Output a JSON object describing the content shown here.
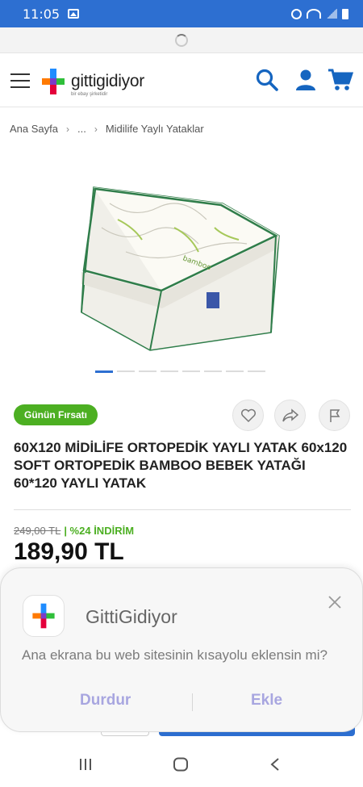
{
  "status_bar": {
    "time": "11:05",
    "icons": [
      "gallery-icon",
      "alarm-icon",
      "wifi-icon",
      "signal-icon",
      "battery-icon"
    ]
  },
  "header": {
    "logo_text": "gittigidiyor",
    "logo_sub": "bir ebay şirketidir",
    "icons": [
      "menu-icon",
      "search-icon",
      "user-icon",
      "cart-icon"
    ],
    "brand_color": "#1565c0"
  },
  "breadcrumb": {
    "items": [
      "Ana Sayfa",
      "...",
      "Midilife Yaylı Yataklar"
    ]
  },
  "product": {
    "badge": "Günün Fırsatı",
    "title": "60X120 MİDİLİFE ORTOPEDİK YAYLI YATAK 60x120 SOFT ORTOPEDİK BAMBOO BEBEK YATAĞI 60*120 YAYLI YATAK",
    "old_price": "249,00 TL",
    "discount": "| %24 İNDİRİM",
    "price": "189,90 TL",
    "image_count": 8,
    "active_image": 1,
    "image_label": "bamboo"
  },
  "install_dialog": {
    "app_name": "GittiGidiyor",
    "message": "Ana ekrana bu web sitesinin kısayolu eklensin mi?",
    "cancel_label": "Durdur",
    "add_label": "Ekle"
  },
  "colors": {
    "status_bar": "#2d6fd1",
    "badge": "#4caf22",
    "discount": "#4caf22",
    "dialog_button": "#a8a6e0"
  }
}
